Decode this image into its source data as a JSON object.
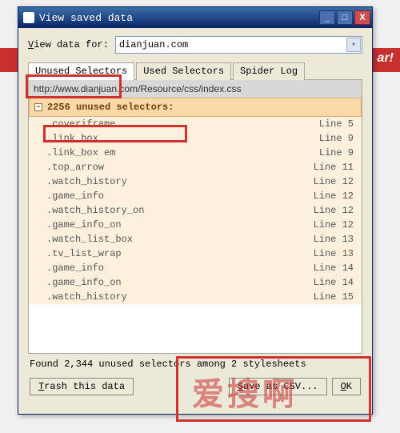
{
  "background": {
    "ar_text": "ar!"
  },
  "dialog": {
    "title": "View saved data",
    "view_label_pre": "V",
    "view_label_post": "iew data for:",
    "domain": "dianjuan.com",
    "tabs": {
      "unused": "Unused Selectors",
      "used": "Used Selectors",
      "spider": "Spider Log"
    },
    "file_path": "http://www.dianjuan.com/Resource/css/index.css",
    "group_header": "2256 unused selectors:",
    "selectors": [
      {
        "name": ".coveriframe",
        "line": "Line 5"
      },
      {
        "name": ".link_box",
        "line": "Line 9"
      },
      {
        "name": ".link_box em",
        "line": "Line 9"
      },
      {
        "name": ".top_arrow",
        "line": "Line 11"
      },
      {
        "name": ".watch_history",
        "line": "Line 12"
      },
      {
        "name": ".game_info",
        "line": "Line 12"
      },
      {
        "name": ".watch_history_on",
        "line": "Line 12"
      },
      {
        "name": ".game_info_on",
        "line": "Line 12"
      },
      {
        "name": ".watch_list_box",
        "line": "Line 13"
      },
      {
        "name": ".tv_list_wrap",
        "line": "Line 13"
      },
      {
        "name": ".game_info",
        "line": "Line 14"
      },
      {
        "name": ".game_info_on",
        "line": "Line 14"
      },
      {
        "name": ".watch_history",
        "line": "Line 15"
      }
    ],
    "summary": "Found 2,344 unused selectors among 2 stylesheets",
    "buttons": {
      "trash_pre": "T",
      "trash_post": "rash this data",
      "save_pre": "S",
      "save_post": "ave as CSV...",
      "ok_pre": "O",
      "ok_post": "K"
    }
  },
  "watermark": "爱搜啊"
}
